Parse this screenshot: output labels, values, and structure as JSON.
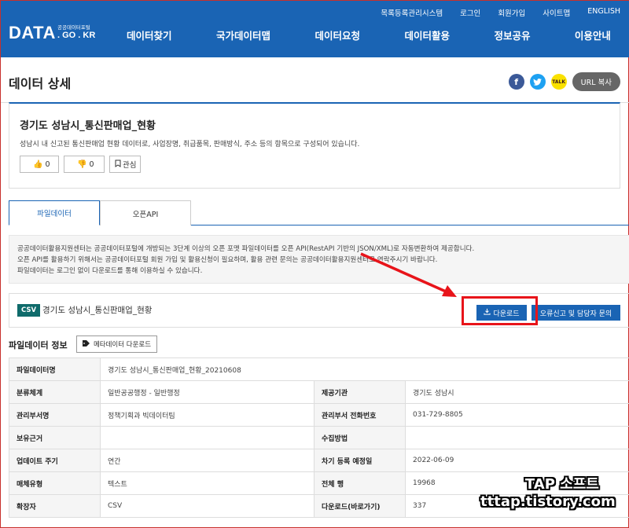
{
  "header": {
    "logo": "DATA",
    "logo_sub": "공공데이터포털",
    "logo_domain": ". GO . KR",
    "util_links": [
      "목록등록관리시스템",
      "로그인",
      "회원가입",
      "사이트맵",
      "ENGLISH"
    ],
    "nav": [
      "데이터찾기",
      "국가데이터맵",
      "데이터요청",
      "데이터활용",
      "정보공유",
      "이용안내"
    ]
  },
  "page": {
    "title": "데이터 상세",
    "url_copy": "URL 복사",
    "share_icons": [
      "facebook-icon",
      "twitter-icon",
      "kakaotalk-icon"
    ]
  },
  "dataset": {
    "title": "경기도 성남시_통신판매업_현황",
    "description": "성남시 내 신고된 통신판매업 현황 데이터로, 사업장명, 취급품목, 판매방식, 주소 등의 항목으로 구성되어 있습니다.",
    "likes": "0",
    "dislikes": "0",
    "favorite_label": "관심"
  },
  "tabs": [
    "파일데이터",
    "오픈API"
  ],
  "notice": [
    "공공데이터활용지원센터는 공공데이터포털에 개방되는 3단계 이상의 오픈 포맷 파일데이터를 오픈 API(RestAPI 기반의 JSON/XML)로 자동변환하여 제공합니다.",
    "오픈 API를 활용하기 위해서는 공공데이터포털 회원 가입 및 활용신청이 필요하며, 활용 관련 문의는 공공데이터활용지원센터로 연락주시기 바랍니다.",
    "파일데이터는 로그인 없이 다운로드를 통해 이용하실 수 있습니다."
  ],
  "file": {
    "badge": "CSV",
    "name": "경기도 성남시_통신판매업_현황",
    "download_label": "다운로드",
    "report_label": "오류신고 및 담당자 문의"
  },
  "meta": {
    "section_title": "파일데이터 정보",
    "download_btn": "메타데이터 다운로드",
    "rows": [
      {
        "k1": "파일데이터명",
        "v1": "경기도 성남시_통신판매업_현황_20210608",
        "k2": "",
        "v2": ""
      },
      {
        "k1": "분류체계",
        "v1": "일반공공행정 - 일반행정",
        "k2": "제공기관",
        "v2": "경기도 성남시"
      },
      {
        "k1": "관리부서명",
        "v1": "정책기획과 빅데이터팀",
        "k2": "관리부서 전화번호",
        "v2": "031-729-8805"
      },
      {
        "k1": "보유근거",
        "v1": "",
        "k2": "수집방법",
        "v2": ""
      },
      {
        "k1": "업데이트 주기",
        "v1": "연간",
        "k2": "차기 등록 예정일",
        "v2": "2022-06-09"
      },
      {
        "k1": "매체유형",
        "v1": "텍스트",
        "k2": "전체 행",
        "v2": "19968"
      },
      {
        "k1": "확장자",
        "v1": "CSV",
        "k2": "다운로드(바로가기)",
        "v2": "337"
      }
    ]
  },
  "watermark": {
    "line1": "TAP 소프트",
    "line2": "tttap.tistory.com"
  },
  "colors": {
    "primary": "#1a64b4",
    "highlight": "#e8141a",
    "csv_badge": "#0f6b6b"
  }
}
